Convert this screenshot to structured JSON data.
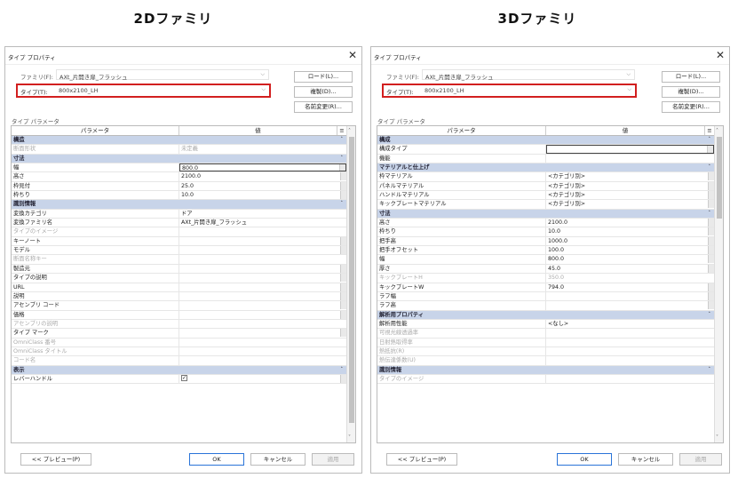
{
  "headings": {
    "left": "2Dファミリ",
    "right": "3Dファミリ"
  },
  "left": {
    "title": "タイプ プロパティ",
    "family_label": "ファミリ(F):",
    "family_value": "AXt_片開き扉_フラッシュ",
    "type_label": "タイプ(T):",
    "type_value": "800x2100_LH",
    "load_btn": "ロード(L)...",
    "dup_btn": "複製(D)...",
    "rename_btn": "名前変更(R)...",
    "section_label": "タイプ パラメータ",
    "col_param": "パラメータ",
    "col_value": "値",
    "rows": [
      {
        "k": "g",
        "p": "構造"
      },
      {
        "k": "d",
        "p": "断面形状",
        "v": "未定義"
      },
      {
        "k": "g",
        "p": "寸法"
      },
      {
        "k": "b",
        "p": "幅",
        "v": "800.0"
      },
      {
        "k": "s",
        "p": "高さ",
        "v": "2100.0"
      },
      {
        "k": "s",
        "p": "枠見付",
        "v": "25.0"
      },
      {
        "k": "s",
        "p": "枠ちり",
        "v": "10.0"
      },
      {
        "k": "g",
        "p": "識別情報"
      },
      {
        "k": "n",
        "p": "変換カテゴリ",
        "v": "ドア"
      },
      {
        "k": "n",
        "p": "変換ファミリ名",
        "v": "AXt_片開き扉_フラッシュ"
      },
      {
        "k": "d",
        "p": "タイプのイメージ",
        "v": ""
      },
      {
        "k": "s",
        "p": "キーノート",
        "v": ""
      },
      {
        "k": "s",
        "p": "モデル",
        "v": ""
      },
      {
        "k": "d",
        "p": "断面名称キー",
        "v": ""
      },
      {
        "k": "s",
        "p": "製造元",
        "v": ""
      },
      {
        "k": "s",
        "p": "タイプの説明",
        "v": ""
      },
      {
        "k": "s",
        "p": "URL",
        "v": ""
      },
      {
        "k": "s",
        "p": "説明",
        "v": ""
      },
      {
        "k": "s",
        "p": "アセンブリ コード",
        "v": ""
      },
      {
        "k": "s",
        "p": "価格",
        "v": ""
      },
      {
        "k": "d",
        "p": "アセンブリの説明",
        "v": ""
      },
      {
        "k": "s",
        "p": "タイプ マーク",
        "v": ""
      },
      {
        "k": "d",
        "p": "OmniClass 番号",
        "v": ""
      },
      {
        "k": "d",
        "p": "OmniClass タイトル",
        "v": ""
      },
      {
        "k": "d",
        "p": "コード名",
        "v": ""
      },
      {
        "k": "g",
        "p": "表示"
      },
      {
        "k": "c",
        "p": "レバーハンドル",
        "v": ""
      }
    ],
    "preview_btn": "<< プレビュー(P)",
    "ok_btn": "OK",
    "cancel_btn": "キャンセル",
    "apply_btn": "適用"
  },
  "right": {
    "title": "タイプ プロパティ",
    "family_label": "ファミリ(F):",
    "family_value": "AXt_片開き扉_フラッシュ",
    "type_label": "タイプ(T):",
    "type_value": "800x2100_LH",
    "load_btn": "ロード(L)...",
    "dup_btn": "複製(D)...",
    "rename_btn": "名前変更(R)...",
    "section_label": "タイプ パラメータ",
    "col_param": "パラメータ",
    "col_value": "値",
    "rows": [
      {
        "k": "g",
        "p": "構成"
      },
      {
        "k": "b",
        "p": "構成タイプ",
        "v": ""
      },
      {
        "k": "n",
        "p": "機能",
        "v": ""
      },
      {
        "k": "g",
        "p": "マテリアルと仕上げ"
      },
      {
        "k": "s",
        "p": "枠マテリアル",
        "v": "<カテゴリ別>"
      },
      {
        "k": "s",
        "p": "パネルマテリアル",
        "v": "<カテゴリ別>"
      },
      {
        "k": "s",
        "p": "ハンドルマテリアル",
        "v": "<カテゴリ別>"
      },
      {
        "k": "s",
        "p": "キックプレートマテリアル",
        "v": "<カテゴリ別>"
      },
      {
        "k": "g",
        "p": "寸法"
      },
      {
        "k": "s",
        "p": "高さ",
        "v": "2100.0"
      },
      {
        "k": "s",
        "p": "枠ちり",
        "v": "10.0"
      },
      {
        "k": "s",
        "p": "把手高",
        "v": "1000.0"
      },
      {
        "k": "s",
        "p": "把手オフセット",
        "v": "100.0"
      },
      {
        "k": "s",
        "p": "幅",
        "v": "800.0"
      },
      {
        "k": "s",
        "p": "厚さ",
        "v": "45.0"
      },
      {
        "k": "d",
        "p": "キックプレートH",
        "v": "350.0"
      },
      {
        "k": "s",
        "p": "キックプレートW",
        "v": "794.0"
      },
      {
        "k": "s",
        "p": "ラフ幅",
        "v": ""
      },
      {
        "k": "s",
        "p": "ラフ高",
        "v": ""
      },
      {
        "k": "g",
        "p": "解析用プロパティ"
      },
      {
        "k": "n",
        "p": "解析用性能",
        "v": "<なし>"
      },
      {
        "k": "d",
        "p": "可視光線透過率",
        "v": ""
      },
      {
        "k": "d",
        "p": "日射熱取得率",
        "v": ""
      },
      {
        "k": "d",
        "p": "熱抵抗(R)",
        "v": ""
      },
      {
        "k": "d",
        "p": "熱伝達係数(U)",
        "v": ""
      },
      {
        "k": "g",
        "p": "識別情報"
      },
      {
        "k": "d",
        "p": "タイプのイメージ",
        "v": ""
      }
    ],
    "preview_btn": "<< プレビュー(P)",
    "ok_btn": "OK",
    "cancel_btn": "キャンセル",
    "apply_btn": "適用"
  }
}
